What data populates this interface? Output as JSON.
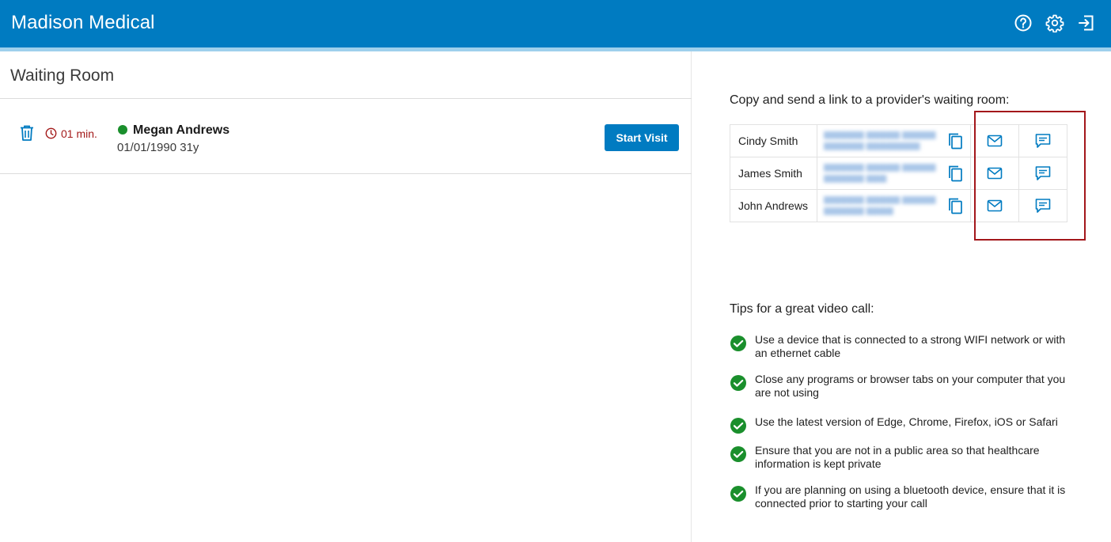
{
  "header": {
    "title": "Madison Medical",
    "icons": [
      "help-icon",
      "settings-icon",
      "logout-icon"
    ]
  },
  "waiting_room": {
    "title": "Waiting Room",
    "patient": {
      "wait_time": "01 min.",
      "name": "Megan Andrews",
      "dob_age": "01/01/1990 31y",
      "status_color": "#1a8f2c"
    },
    "start_button_label": "Start Visit"
  },
  "provider_links": {
    "heading": "Copy and send a link to a provider's waiting room:",
    "providers": [
      {
        "name": "Cindy Smith"
      },
      {
        "name": "James Smith"
      },
      {
        "name": "John Andrews"
      }
    ],
    "highlight_color": "#a3171b"
  },
  "tips": {
    "heading": "Tips for a great video call:",
    "items": [
      "Use a device that is connected to a strong WIFI network or with an ethernet cable",
      "Close any programs or browser tabs on your computer that you are not using",
      "Use the latest version of Edge, Chrome, Firefox, iOS or Safari",
      "Ensure that you are not in a public area so that healthcare information is kept private",
      "If you are planning on using a bluetooth device, ensure that it is connected prior to starting your call"
    ]
  },
  "colors": {
    "brand": "#007bc1",
    "check": "#1a8f2c",
    "timer": "#a31a1a"
  }
}
